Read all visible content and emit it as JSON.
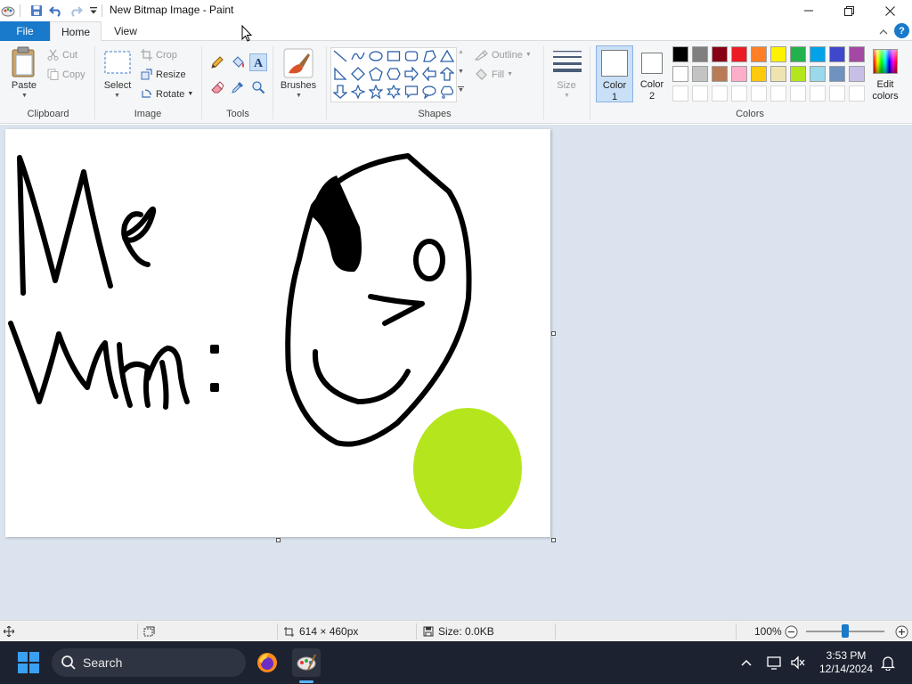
{
  "window": {
    "title": "New Bitmap Image - Paint"
  },
  "tabs": {
    "file": "File",
    "home": "Home",
    "view": "View",
    "help": "?"
  },
  "ribbon": {
    "clipboard": {
      "label": "Clipboard",
      "paste": "Paste",
      "cut": "Cut",
      "copy": "Copy"
    },
    "image": {
      "label": "Image",
      "select": "Select",
      "crop": "Crop",
      "resize": "Resize",
      "rotate": "Rotate"
    },
    "tools": {
      "label": "Tools",
      "active_tool": "text-icon"
    },
    "brushes": {
      "label": "Brushes"
    },
    "shapes": {
      "label": "Shapes",
      "outline": "Outline",
      "fill": "Fill"
    },
    "size": {
      "label": "Size"
    },
    "colors": {
      "label": "Colors",
      "color1_line1": "Color",
      "color1_line2": "1",
      "color2_line1": "Color",
      "color2_line2": "2",
      "edit_line1": "Edit",
      "edit_line2": "colors",
      "palette_row1": [
        "#000000",
        "#7f7f7f",
        "#880015",
        "#ed1c24",
        "#ff7f27",
        "#fff200",
        "#22b14c",
        "#00a2e8",
        "#3f48cc",
        "#a349a4"
      ],
      "palette_row2": [
        "#ffffff",
        "#c3c3c3",
        "#b97a57",
        "#ffaec9",
        "#ffc90e",
        "#efe4b0",
        "#b5e61d",
        "#99d9ea",
        "#7092be",
        "#c8bfe7"
      ],
      "color1": "#ffffff",
      "color2": "#ffffff"
    }
  },
  "canvas": {
    "text_line1": "Me",
    "text_line2": "Whn:",
    "circle_color": "#b5e61d"
  },
  "statusbar": {
    "dimensions": "614 × 460px",
    "size": "Size: 0.0KB",
    "zoom": "100%",
    "zoom_fraction": 0.5
  },
  "taskbar": {
    "search_placeholder": "Search",
    "time": "3:53 PM",
    "date": "12/14/2024"
  }
}
